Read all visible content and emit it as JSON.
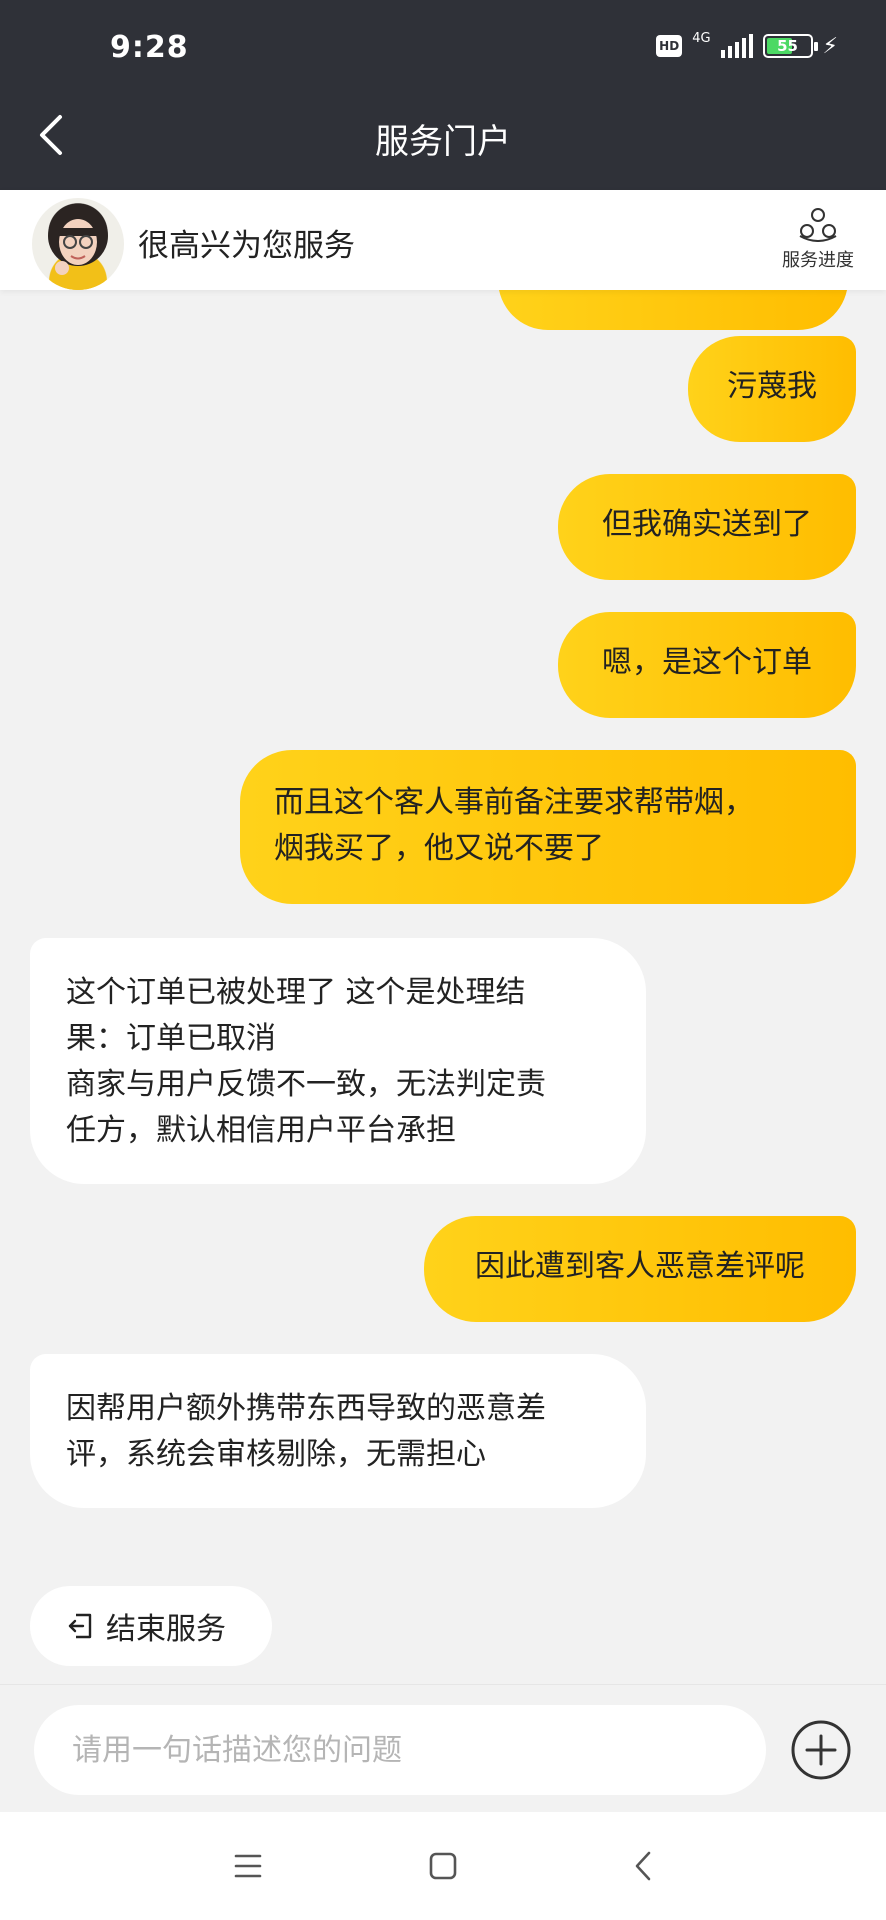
{
  "status_bar": {
    "time": "9:28",
    "hd_label": "HD",
    "network_label": "4G",
    "battery_level": "55"
  },
  "title_bar": {
    "title": "服务门户",
    "back_icon": "chevron-left-icon"
  },
  "agent": {
    "greeting": "很高兴为您服务",
    "progress_label": "服务进度",
    "progress_icon": "nodes-icon"
  },
  "messages": [
    {
      "from": "user",
      "text": "污蔑我"
    },
    {
      "from": "user",
      "text": "但我确实送到了"
    },
    {
      "from": "user",
      "text": "嗯，是这个订单"
    },
    {
      "from": "user",
      "lines": [
        "而且这个客人事前备注要求帮带烟，",
        "烟我买了，他又说不要了"
      ]
    },
    {
      "from": "agent",
      "lines": [
        "这个订单已被处理了  这个是处理结",
        "果：订单已取消",
        "商家与用户反馈不一致，无法判定责",
        "任方，默认相信用户平台承担"
      ]
    },
    {
      "from": "user",
      "text": "因此遭到客人恶意差评呢"
    },
    {
      "from": "agent",
      "lines": [
        "因帮用户额外携带东西导致的恶意差",
        "评，系统会审核剔除，无需担心"
      ]
    }
  ],
  "end_service": {
    "label": "结束服务",
    "icon": "exit-icon"
  },
  "input": {
    "placeholder": "请用一句话描述您的问题",
    "value": "",
    "add_icon": "plus-circle-icon"
  },
  "nav": {
    "menu_icon": "menu-icon",
    "home_icon": "square-icon",
    "back_icon": "back-icon"
  },
  "colors": {
    "bar_bg": "#2f3138",
    "bubble_user": "#ffc90a",
    "page_bg": "#f2f2f2"
  }
}
